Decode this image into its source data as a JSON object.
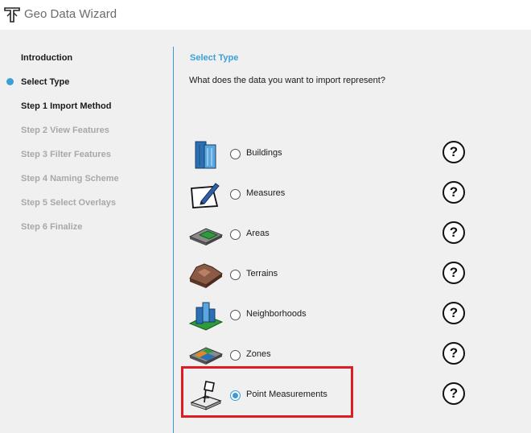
{
  "window": {
    "title": "Geo Data Wizard"
  },
  "sidebar": {
    "items": [
      {
        "label": "Introduction",
        "state": "done"
      },
      {
        "label": "Select Type",
        "state": "current"
      },
      {
        "label": "Step 1 Import Method",
        "state": "enabled"
      },
      {
        "label": "Step 2 View Features",
        "state": "disabled"
      },
      {
        "label": "Step 3 Filter Features",
        "state": "disabled"
      },
      {
        "label": "Step 4 Naming Scheme",
        "state": "disabled"
      },
      {
        "label": "Step 5 Select Overlays",
        "state": "disabled"
      },
      {
        "label": "Step 6 Finalize",
        "state": "disabled"
      }
    ]
  },
  "main": {
    "section_title": "Select Type",
    "question": "What does the data you want to import represent?",
    "options": [
      {
        "label": "Buildings",
        "icon": "buildings-icon",
        "checked": false
      },
      {
        "label": "Measures",
        "icon": "measures-icon",
        "checked": false
      },
      {
        "label": "Areas",
        "icon": "areas-icon",
        "checked": false
      },
      {
        "label": "Terrains",
        "icon": "terrains-icon",
        "checked": false
      },
      {
        "label": "Neighborhoods",
        "icon": "neighborhoods-icon",
        "checked": false
      },
      {
        "label": "Zones",
        "icon": "zones-icon",
        "checked": false
      },
      {
        "label": "Point Measurements",
        "icon": "point-measurements-icon",
        "checked": true
      }
    ],
    "help_label": "?",
    "highlight_color": "#e01b24",
    "accent_color": "#3aa0d8"
  }
}
